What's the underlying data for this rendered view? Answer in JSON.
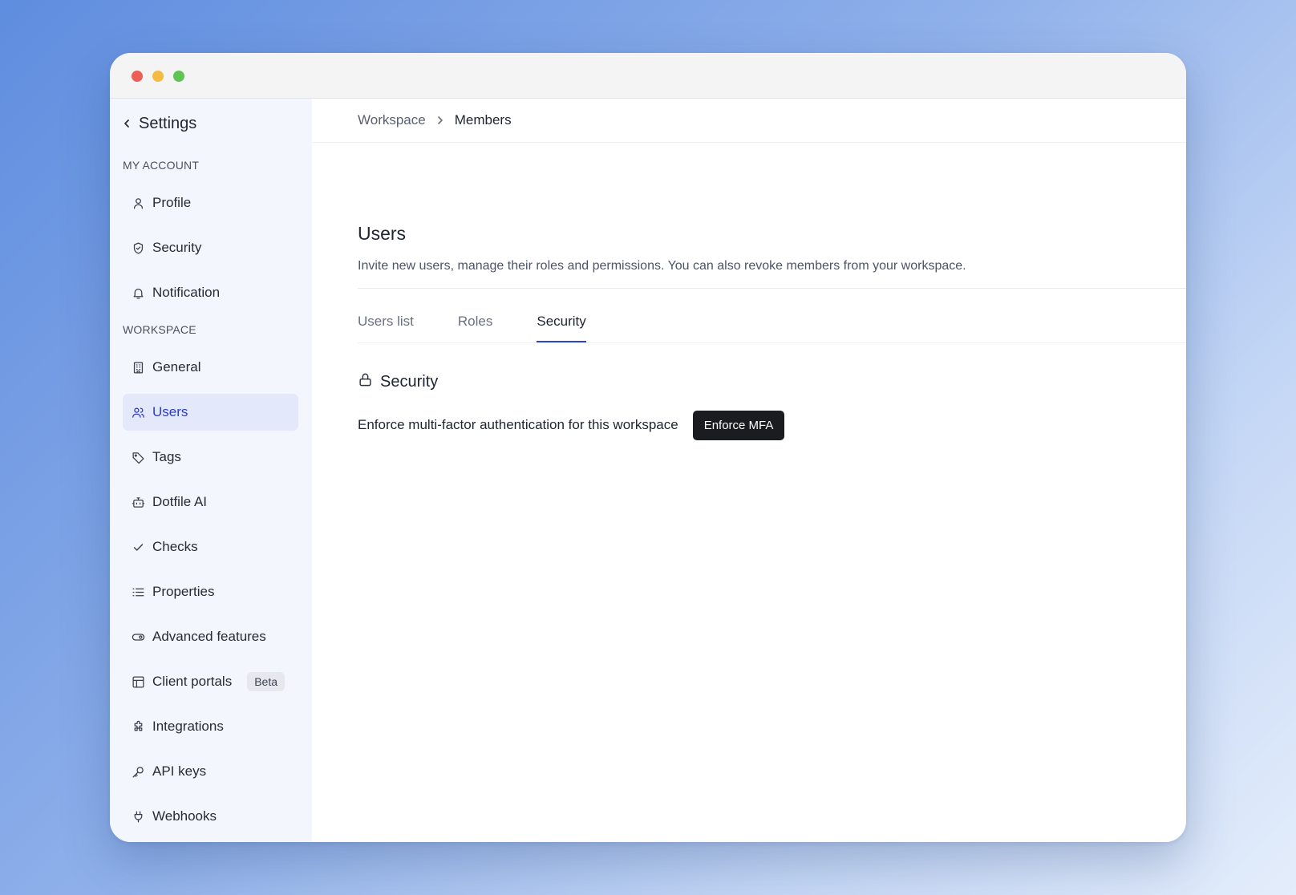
{
  "window": {
    "controls": [
      "close",
      "minimize",
      "maximize"
    ]
  },
  "sidebar": {
    "title": "Settings",
    "sections": [
      {
        "label": "MY ACCOUNT",
        "items": [
          {
            "label": "Profile",
            "icon": "user-icon"
          },
          {
            "label": "Security",
            "icon": "shield-icon"
          },
          {
            "label": "Notification",
            "icon": "bell-icon"
          }
        ]
      },
      {
        "label": "WORKSPACE",
        "items": [
          {
            "label": "General",
            "icon": "building-icon"
          },
          {
            "label": "Users",
            "icon": "users-icon",
            "active": true
          },
          {
            "label": "Tags",
            "icon": "tag-icon"
          },
          {
            "label": "Dotfile AI",
            "icon": "bot-icon"
          },
          {
            "label": "Checks",
            "icon": "check-icon"
          },
          {
            "label": "Properties",
            "icon": "list-icon"
          },
          {
            "label": "Advanced features",
            "icon": "toggle-icon"
          },
          {
            "label": "Client portals",
            "icon": "layout-icon",
            "badge": "Beta"
          },
          {
            "label": "Integrations",
            "icon": "puzzle-icon"
          },
          {
            "label": "API keys",
            "icon": "key-icon"
          },
          {
            "label": "Webhooks",
            "icon": "plug-icon"
          }
        ]
      }
    ]
  },
  "breadcrumb": {
    "parent": "Workspace",
    "current": "Members"
  },
  "main": {
    "title": "Users",
    "description": "Invite new users, manage their roles and permissions. You can also revoke members from your workspace.",
    "tabs": [
      {
        "label": "Users list",
        "active": false
      },
      {
        "label": "Roles",
        "active": false
      },
      {
        "label": "Security",
        "active": true
      }
    ],
    "security": {
      "title": "Security",
      "mfa_text": "Enforce multi-factor authentication for this workspace",
      "mfa_button": "Enforce MFA"
    }
  },
  "colors": {
    "accent": "#2c3ec2",
    "active_bg": "#e3e9fb",
    "sidebar_bg": "#f3f6fd",
    "button_bg": "#1b1c1f"
  }
}
